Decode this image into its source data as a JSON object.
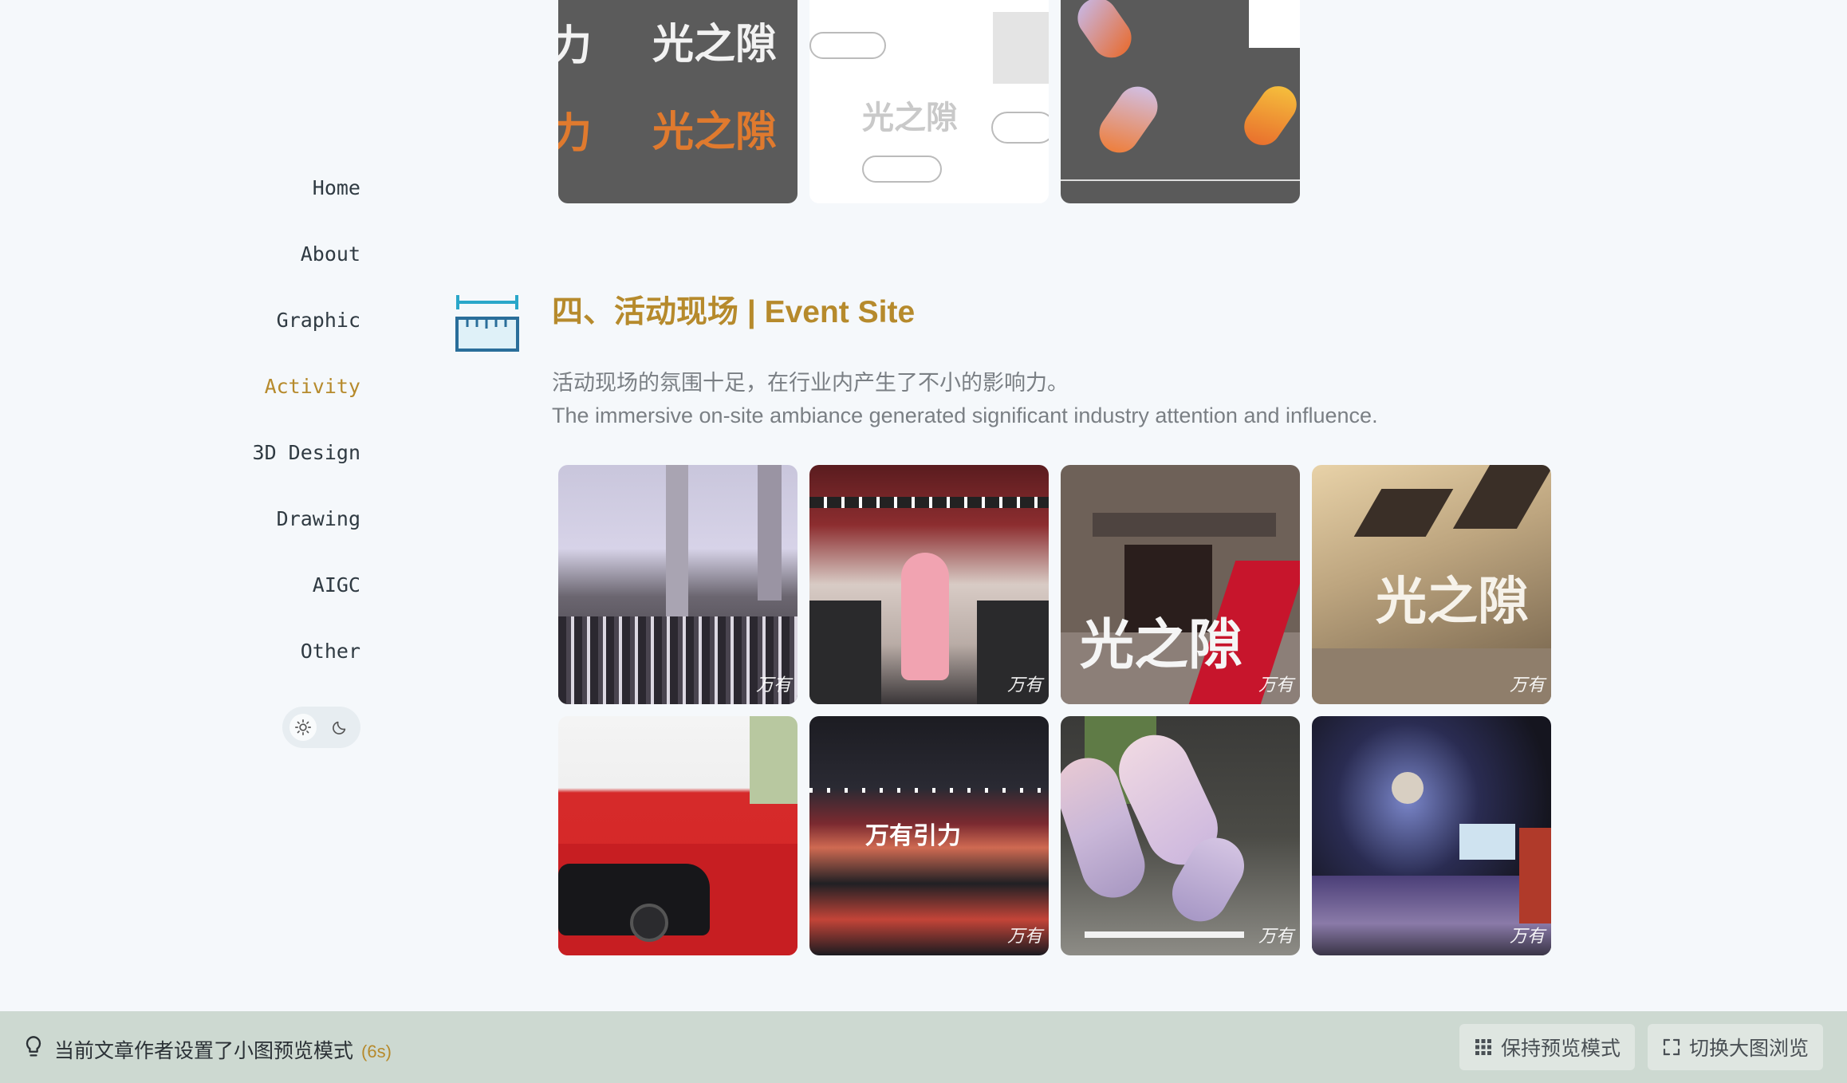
{
  "sidebar": {
    "nav": [
      {
        "label": "Home",
        "active": false
      },
      {
        "label": "About",
        "active": false
      },
      {
        "label": "Graphic",
        "active": false
      },
      {
        "label": "Activity",
        "active": true
      },
      {
        "label": "3D Design",
        "active": false
      },
      {
        "label": "Drawing",
        "active": false
      },
      {
        "label": "AIGC",
        "active": false
      },
      {
        "label": "Other",
        "active": false
      }
    ],
    "theme_toggle": {
      "options": [
        "sun-icon",
        "moon-icon"
      ],
      "selected": "sun-icon"
    }
  },
  "top_gallery": {
    "images": [
      {
        "caption_a": "力",
        "caption_b": "光之隙",
        "caption_c": "力",
        "caption_d": "光之隙"
      },
      {
        "caption": "光之隙"
      },
      {
        "caption": ""
      }
    ]
  },
  "section": {
    "title": "四、活动现场 | Event Site",
    "desc_zh": "活动现场的氛围十足，在行业内产生了不小的影响力。",
    "desc_en": "The immersive on-site ambiance generated significant industry attention and influence."
  },
  "event_gallery": {
    "watermark": "万有",
    "images": [
      {
        "caption": ""
      },
      {
        "caption": ""
      },
      {
        "caption": "光之隙"
      },
      {
        "caption": "光之隙"
      },
      {
        "caption": ""
      },
      {
        "caption": "万有引力"
      },
      {
        "caption": ""
      },
      {
        "caption": ""
      }
    ]
  },
  "notice": {
    "text": "当前文章作者设置了小图预览模式",
    "countdown": "(6s)",
    "keep_label": "保持预览模式",
    "switch_label": "切换大图浏览"
  },
  "colors": {
    "accent": "#b68a2c",
    "background": "#f5f8fb",
    "notice_bar": "#cdd9d1",
    "icon_blue": "#2a7fa8"
  }
}
